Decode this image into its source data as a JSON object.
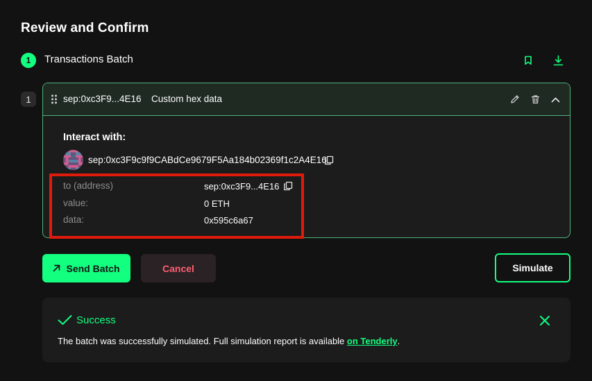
{
  "page": {
    "title": "Review and Confirm"
  },
  "step": {
    "number": "1",
    "label": "Transactions Batch",
    "bookmark_icon": "bookmark-icon",
    "download_icon": "download-icon"
  },
  "transaction": {
    "index": "1",
    "short_address": "sep:0xc3F9...4E16",
    "type_label": "Custom hex data",
    "edit_icon": "pencil-icon",
    "delete_icon": "trash-icon",
    "collapse_icon": "chevron-up-icon",
    "interact_label": "Interact with:",
    "full_address": "sep:0xc3F9c9f9CABdCe9679F5Aa184b02369f1c2A4E16",
    "details": [
      {
        "key": "to (address)",
        "value": "sep:0xc3F9...4E16"
      },
      {
        "key": "value:",
        "value": "0 ETH"
      },
      {
        "key": "data:",
        "value": "0x595c6a67"
      }
    ]
  },
  "actions": {
    "send_label": "Send Batch",
    "cancel_label": "Cancel",
    "simulate_label": "Simulate"
  },
  "simulation": {
    "status": "Success",
    "message": "The batch was successfully simulated. Full simulation report is available ",
    "link_text": "on Tenderly",
    "message_end": "."
  },
  "colors": {
    "background": "#121212",
    "accent": "#12ff80",
    "card_border": "#4fb37c",
    "danger_text": "#ff5f72",
    "highlight": "#e01b0c"
  }
}
